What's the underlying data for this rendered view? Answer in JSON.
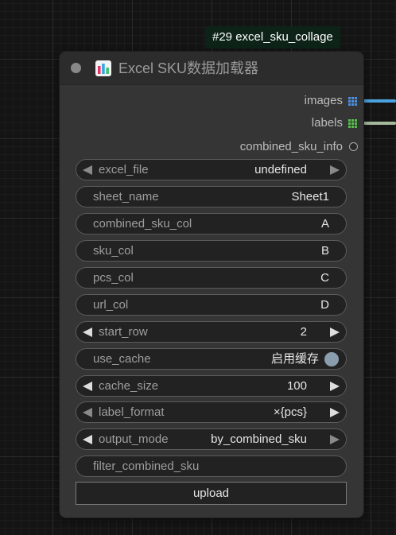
{
  "node_badge": "#29 excel_sku_collage",
  "node": {
    "title": "Excel SKU数据加载器",
    "outputs": [
      {
        "label": "images",
        "icon": "grid-icon",
        "color": "#4a90e2"
      },
      {
        "label": "labels",
        "icon": "grid-icon",
        "color": "#55c04a"
      },
      {
        "label": "combined_sku_info",
        "icon": "circle-icon"
      }
    ],
    "widgets": [
      {
        "label": "excel_file",
        "value": "undefined",
        "type": "combo"
      },
      {
        "label": "sheet_name",
        "value": "Sheet1",
        "type": "text"
      },
      {
        "label": "combined_sku_col",
        "value": "A",
        "type": "text"
      },
      {
        "label": "sku_col",
        "value": "B",
        "type": "text"
      },
      {
        "label": "pcs_col",
        "value": "C",
        "type": "text"
      },
      {
        "label": "url_col",
        "value": "D",
        "type": "text"
      },
      {
        "label": "start_row",
        "value": "2",
        "type": "number"
      },
      {
        "label": "use_cache",
        "value": "启用缓存",
        "type": "toggle"
      },
      {
        "label": "cache_size",
        "value": "100",
        "type": "number"
      },
      {
        "label": "label_format",
        "value": "×{pcs}",
        "type": "combo"
      },
      {
        "label": "output_mode",
        "value": "by_combined_sku",
        "type": "combo"
      },
      {
        "label": "filter_combined_sku",
        "value": "",
        "type": "text"
      }
    ],
    "upload_label": "upload"
  },
  "colors": {
    "images_wire": "#4aa3e0",
    "labels_wire": "#a4b89c",
    "toggle_knob": "#8a9dae"
  }
}
